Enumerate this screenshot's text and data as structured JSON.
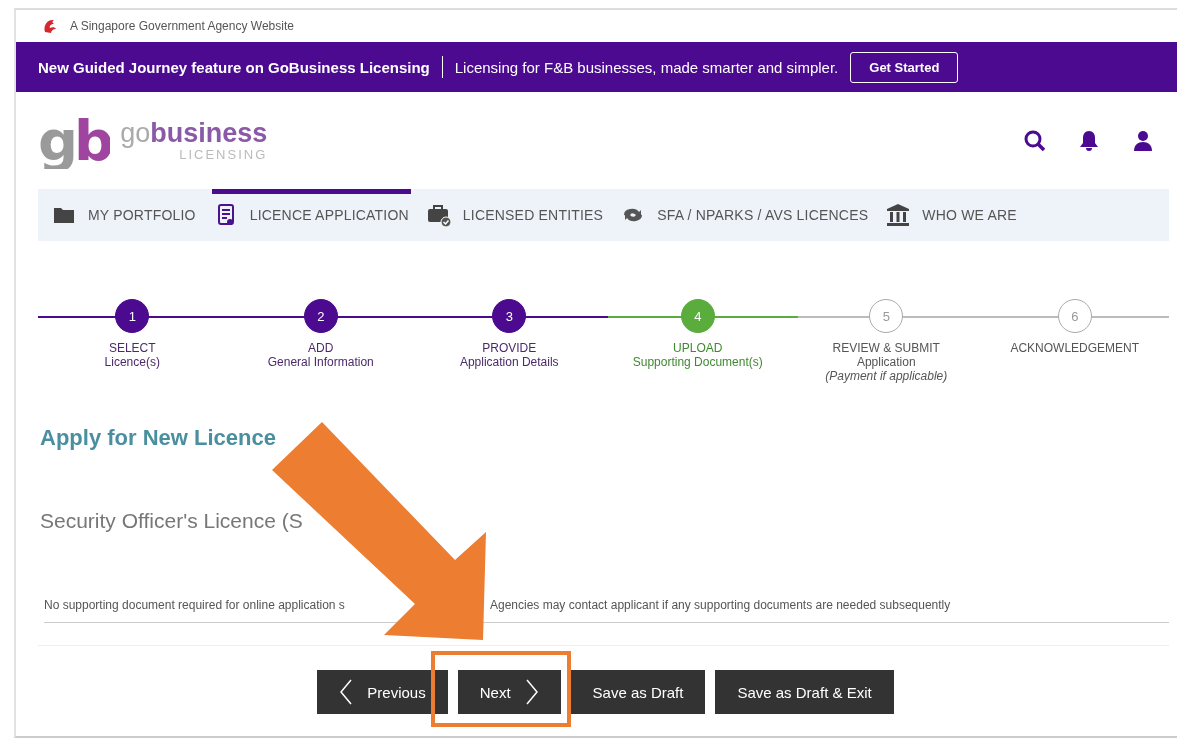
{
  "gov_bar": {
    "text": "A Singapore Government Agency Website"
  },
  "announcement": {
    "title": "New Guided Journey feature on GoBusiness Licensing",
    "message": "Licensing for F&B businesses, made smarter and simpler.",
    "button": "Get Started"
  },
  "header": {
    "logo_mark": "gb",
    "brand_prefix": "go",
    "brand_name": "business",
    "brand_sub": "LICENSING"
  },
  "nav": [
    {
      "label": "MY PORTFOLIO",
      "kind": "folder",
      "selected": false
    },
    {
      "label": "LICENCE APPLICATION",
      "kind": "document",
      "selected": true
    },
    {
      "label": "LICENSED ENTITIES",
      "kind": "briefcase",
      "selected": false
    },
    {
      "label": "SFA / NPARKS / AVS LICENCES",
      "kind": "exchange",
      "selected": false
    },
    {
      "label": "WHO WE ARE",
      "kind": "building",
      "selected": false
    }
  ],
  "steps": [
    {
      "number": "1",
      "title": "SELECT",
      "subtitle": "Licence(s)",
      "completed": true,
      "current": false
    },
    {
      "number": "2",
      "title": "ADD",
      "subtitle": "General Information",
      "completed": true,
      "current": false
    },
    {
      "number": "3",
      "title": "PROVIDE",
      "subtitle": "Application Details",
      "completed": true,
      "current": false
    },
    {
      "number": "4",
      "title": "UPLOAD",
      "subtitle": "Supporting Document(s)",
      "completed": false,
      "current": true
    },
    {
      "number": "5",
      "title": "REVIEW & SUBMIT",
      "subtitle": "Application",
      "note": "(Payment if applicable)",
      "completed": false,
      "current": false
    },
    {
      "number": "6",
      "title": "ACKNOWLEDGEMENT",
      "completed": false,
      "current": false
    }
  ],
  "page_title": "Apply for New Licence",
  "licence_name": "Security Officer's Licence (S",
  "info": [
    "No supporting document required for online application s",
    "Agencies may contact applicant if any supporting documents are needed subsequently"
  ],
  "buttons": [
    {
      "label": "Previous",
      "kind": "previous"
    },
    {
      "label": "Next",
      "kind": "next"
    },
    {
      "label": "Save as Draft",
      "kind": "plain"
    },
    {
      "label": "Save as Draft & Exit",
      "kind": "plain"
    }
  ]
}
